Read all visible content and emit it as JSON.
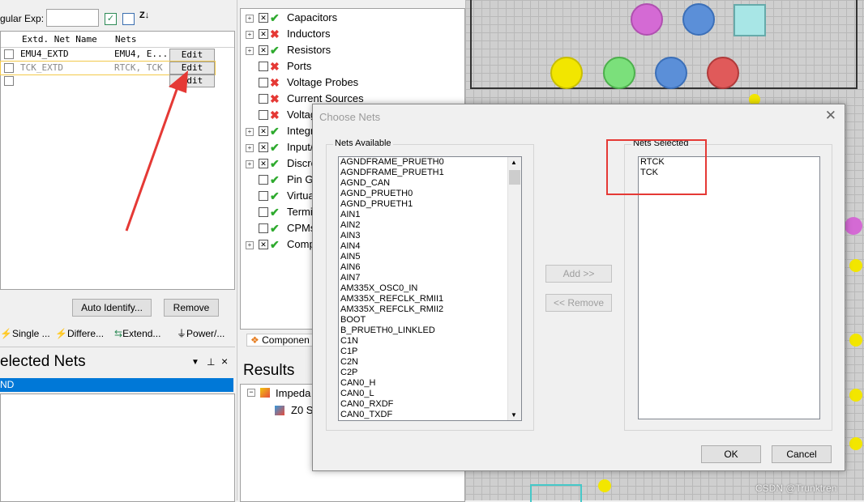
{
  "left_panel": {
    "regexp_label": "gular Exp:",
    "regexp_value": "",
    "sort_icon_text": "Z↓",
    "grid": {
      "headers": [
        "Extd. Net Name",
        "Nets"
      ],
      "rows": [
        {
          "name": "EMU4_EXTD",
          "nets": "EMU4, E...",
          "edit": "Edit"
        },
        {
          "name": "TCK_EXTD",
          "nets": "RTCK, TCK",
          "edit": "Edit"
        },
        {
          "name": "",
          "nets": "",
          "edit": "Edit"
        }
      ]
    },
    "buttons": {
      "auto_identify": "Auto Identify...",
      "remove": "Remove"
    },
    "tabs": [
      "Single ...",
      "Differe...",
      "Extend...",
      "Power/..."
    ],
    "selected_nets_title": "elected Nets",
    "selected_nets_row": "ND"
  },
  "tree": {
    "items": [
      {
        "label": "Capacitors",
        "status": "check",
        "expand": "+"
      },
      {
        "label": "Inductors",
        "status": "x",
        "expand": "+"
      },
      {
        "label": "Resistors",
        "status": "check",
        "expand": "+"
      },
      {
        "label": "Ports",
        "status": "x",
        "expand": ""
      },
      {
        "label": "Voltage Probes",
        "status": "x",
        "expand": ""
      },
      {
        "label": "Current Sources",
        "status": "x",
        "expand": ""
      },
      {
        "label": "Voltag",
        "status": "x",
        "expand": ""
      },
      {
        "label": "Integr",
        "status": "check",
        "expand": "+"
      },
      {
        "label": "Input/",
        "status": "check",
        "expand": "+"
      },
      {
        "label": "Discre",
        "status": "check",
        "expand": "+"
      },
      {
        "label": "Pin Gr",
        "status": "check",
        "expand": ""
      },
      {
        "label": "Virtua",
        "status": "check",
        "expand": ""
      },
      {
        "label": "Termi",
        "status": "check",
        "expand": ""
      },
      {
        "label": "CPMs",
        "status": "check",
        "expand": ""
      },
      {
        "label": "Comp",
        "status": "check",
        "expand": "+"
      }
    ],
    "bottom_tab": "Componen"
  },
  "results": {
    "title": "Results",
    "items": [
      "Impeda",
      "Z0 S"
    ]
  },
  "dialog": {
    "title": "Choose Nets",
    "nets_available_label": "Nets Available",
    "nets_available": [
      "AGNDFRAME_PRUETH0",
      "AGNDFRAME_PRUETH1",
      "AGND_CAN",
      "AGND_PRUETH0",
      "AGND_PRUETH1",
      "AIN1",
      "AIN2",
      "AIN3",
      "AIN4",
      "AIN5",
      "AIN6",
      "AIN7",
      "AM335X_OSC0_IN",
      "AM335X_REFCLK_RMII1",
      "AM335X_REFCLK_RMII2",
      "BOOT",
      "B_PRUETH0_LINKLED",
      "C1N",
      "C1P",
      "C2N",
      "C2P",
      "CAN0_H",
      "CAN0_L",
      "CAN0_RXDF",
      "CAN0_TXDF"
    ],
    "nets_selected_label": "Nets Selected",
    "nets_selected": [
      "RTCK",
      "TCK"
    ],
    "add_button": "Add >>",
    "remove_button": "<< Remove",
    "ok_button": "OK",
    "cancel_button": "Cancel"
  },
  "watermark": "CSDN @Trunktren",
  "colors": {
    "selection": "#0078d7",
    "annotation_red": "#e53935"
  }
}
